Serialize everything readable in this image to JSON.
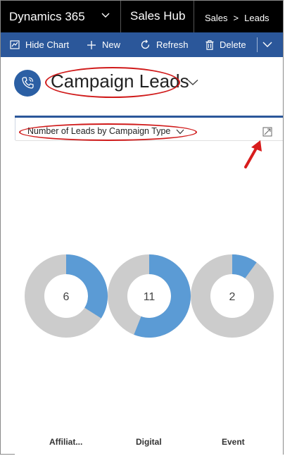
{
  "nav": {
    "app_name": "Dynamics 365",
    "hub_name": "Sales Hub",
    "breadcrumb": [
      "Sales",
      "Leads"
    ],
    "breadcrumb_separator": ">"
  },
  "commands": [
    {
      "label": "Hide Chart",
      "icon": "chart-icon"
    },
    {
      "label": "New",
      "icon": "plus-icon"
    },
    {
      "label": "Refresh",
      "icon": "refresh-icon"
    },
    {
      "label": "Delete",
      "icon": "trash-icon"
    }
  ],
  "page": {
    "title": "Campaign Leads",
    "icon": "phone-icon"
  },
  "chart": {
    "title": "Number of Leads by Campaign Type"
  },
  "colors": {
    "nav_bg": "#000000",
    "command_bg": "#2b579a",
    "accent": "#2b579a",
    "donut_blue": "#5b9bd5",
    "donut_gray": "#cccccc",
    "annotation_red": "#d01a1a"
  },
  "chart_data": {
    "type": "pie",
    "title": "Number of Leads by Campaign Type",
    "categories": [
      "Affiliat...",
      "Digital",
      "Event"
    ],
    "center_values": [
      6,
      11,
      2
    ],
    "series": [
      {
        "values": [
          0.34,
          0.56,
          0.1
        ]
      }
    ]
  }
}
